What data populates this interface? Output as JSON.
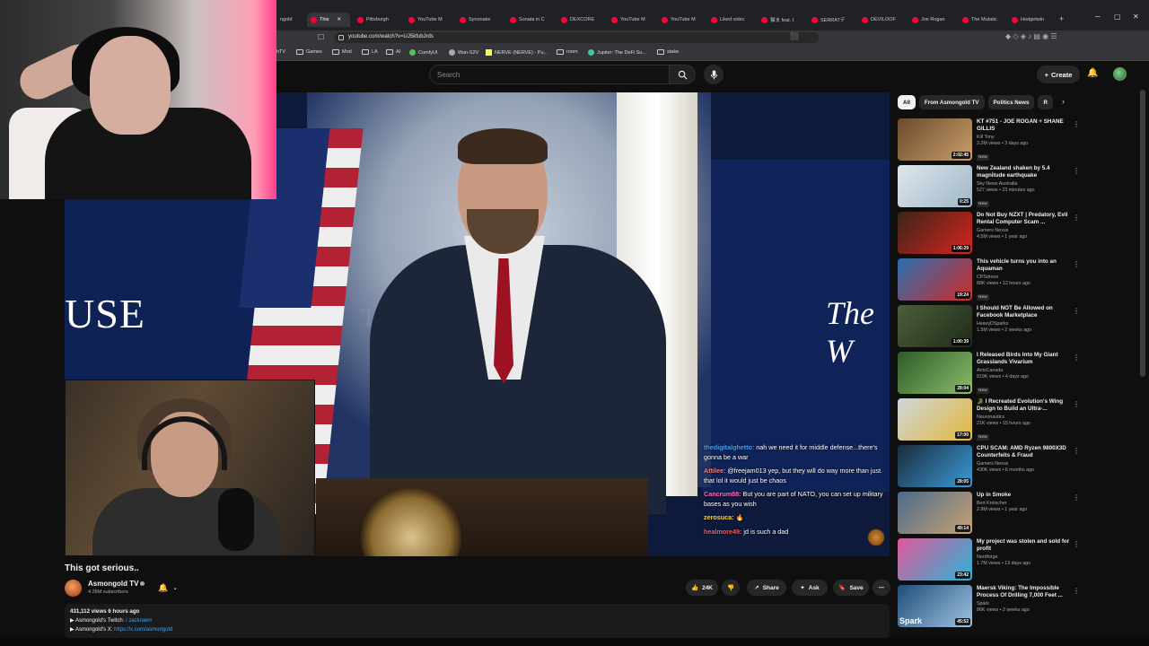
{
  "browser": {
    "tabs": [
      {
        "label": "ngold"
      },
      {
        "label": "This",
        "active": true
      },
      {
        "label": "Pittsburgh"
      },
      {
        "label": "YouTube M"
      },
      {
        "label": "Synonake"
      },
      {
        "label": "Sonata in C"
      },
      {
        "label": "DEXCORE"
      },
      {
        "label": "YouTube M"
      },
      {
        "label": "YouTube M"
      },
      {
        "label": "Liked videc"
      },
      {
        "label": "猫ま feat. I"
      },
      {
        "label": "SERRATデ"
      },
      {
        "label": "DEVILOOF"
      },
      {
        "label": "Joe Rogan"
      },
      {
        "label": "The Mutatic"
      },
      {
        "label": "Hodgetwin"
      }
    ],
    "new_tab_label": "+",
    "url": "youtube.com/watch?v=UJ5kfubJrds",
    "bookmarks": [
      "hTV",
      "Games",
      "Mod",
      "LA",
      "AI",
      "ComfyUI",
      "Wan-S2V",
      "NERVE (NERVE) - Pu...",
      "room",
      "Jupiter: The DeFi Su...",
      "stake"
    ]
  },
  "youtube": {
    "search_placeholder": "Search",
    "create_label": "Create"
  },
  "video": {
    "overlay_left_text": "USE",
    "overlay_right_text": "The W",
    "backdrop_text": "TH",
    "title": "This got serious..",
    "chat": [
      {
        "user": "thedigitalghetto:",
        "text": "nah we need it for middle defense...there's gonna be a war"
      },
      {
        "user": "Attilee:",
        "text": "@freejam013 yep, but they will do way more than just that lol it would just be chaos"
      },
      {
        "user": "Cancrum88:",
        "text": "But you are part of NATO, you can set up military bases as you wish"
      },
      {
        "user": "zerosuca:",
        "text": "🔥"
      },
      {
        "user": "healmore49:",
        "text": "jd is such a dad"
      }
    ]
  },
  "channel": {
    "name": "Asmongold TV",
    "subscribers": "4.28M subscribers"
  },
  "actions": {
    "likes": "24K",
    "share": "Share",
    "ask": "Ask",
    "save": "Save"
  },
  "description": {
    "meta": "431,112 views  6 hours ago",
    "line1_prefix": "▶ Asmongold's Twitch:",
    "line1_link": "/ zackrawrr",
    "line2_prefix": "▶ Asmongold's X:",
    "line2_link": "https://x.com/asmongold"
  },
  "sidebar": {
    "chips": [
      {
        "label": "All",
        "active": true
      },
      {
        "label": "From Asmongold TV"
      },
      {
        "label": "Politics News"
      },
      {
        "label": "R"
      }
    ],
    "recommendations": [
      {
        "title": "KT #751 - JOE ROGAN + SHANE GILLIS",
        "channel": "Kill Tony",
        "meta": "3.2M views • 3 days ago",
        "badge": "New",
        "duration": "2:02:45",
        "color1": "#6b4a2e",
        "color2": "#c9a06a"
      },
      {
        "title": "New Zealand shaken by 5.4 magnitude earthquake",
        "channel": "Sky News Australia",
        "meta": "527 views • 23 minutes ago",
        "badge": "New",
        "duration": "0:25",
        "color1": "#dfe6ec",
        "color2": "#9fb7c9"
      },
      {
        "title": "Do Not Buy NZXT | Predatory, Evil Rental Computer Scam ...",
        "channel": "Gamers Nexus",
        "meta": "4.5M views • 1 year ago",
        "badge": "",
        "duration": "1:06:29",
        "color1": "#3a2518",
        "color2": "#d8241f"
      },
      {
        "title": "This vehicle turns you into an Aquaman",
        "channel": "CPSdrone",
        "meta": "88K views • 12 hours ago",
        "badge": "New",
        "duration": "19:24",
        "color1": "#2a6fb0",
        "color2": "#d02b2b"
      },
      {
        "title": "I Should NOT Be Allowed on Facebook Marketplace",
        "channel": "HeavyDSparks",
        "meta": "1.5M views • 2 weeks ago",
        "badge": "",
        "duration": "1:00:39",
        "color1": "#4d5e3a",
        "color2": "#1f2a19"
      },
      {
        "title": "I Released Birds Into My Giant Grasslands Vivarium",
        "channel": "AntsCanada",
        "meta": "819K views • 4 days ago",
        "badge": "New",
        "duration": "28:04",
        "color1": "#2f5a2a",
        "color2": "#8bbd6a"
      },
      {
        "title": "🐊 I Recreated Evolution's Wing Design to Build an Ultra-...",
        "channel": "Neuronautics",
        "meta": "21K views • 15 hours ago",
        "badge": "New",
        "duration": "17:00",
        "color1": "#cfd6dc",
        "color2": "#e2b83b"
      },
      {
        "title": "CPU SCAM: AMD Ryzen 9800X3D Counterfeits & Fraud",
        "channel": "Gamers Nexus",
        "meta": "430K views • 6 months ago",
        "badge": "",
        "duration": "28:05",
        "color1": "#1a2b3c",
        "color2": "#3a9bd8"
      },
      {
        "title": "Up in Smoke",
        "channel": "Bert Kreischer",
        "meta": "2.9M views • 1 year ago",
        "badge": "",
        "duration": "49:14",
        "color1": "#4b6b8a",
        "color2": "#c8a276"
      },
      {
        "title": "My project was stolen and sold for profit",
        "channel": "Nerdforge",
        "meta": "1.7M views • 13 days ago",
        "badge": "",
        "duration": "23:42",
        "color1": "#e05a9a",
        "color2": "#2ab3d6"
      },
      {
        "title": "Maersk Viking: The Impossible Process Of Drilling 7,000 Feet ...",
        "channel": "Spark",
        "meta": "86K views • 2 weeks ago",
        "badge": "",
        "duration": "45:52",
        "color1": "#1f4d7a",
        "color2": "#9fc3e0",
        "logo": "Spark"
      }
    ]
  }
}
